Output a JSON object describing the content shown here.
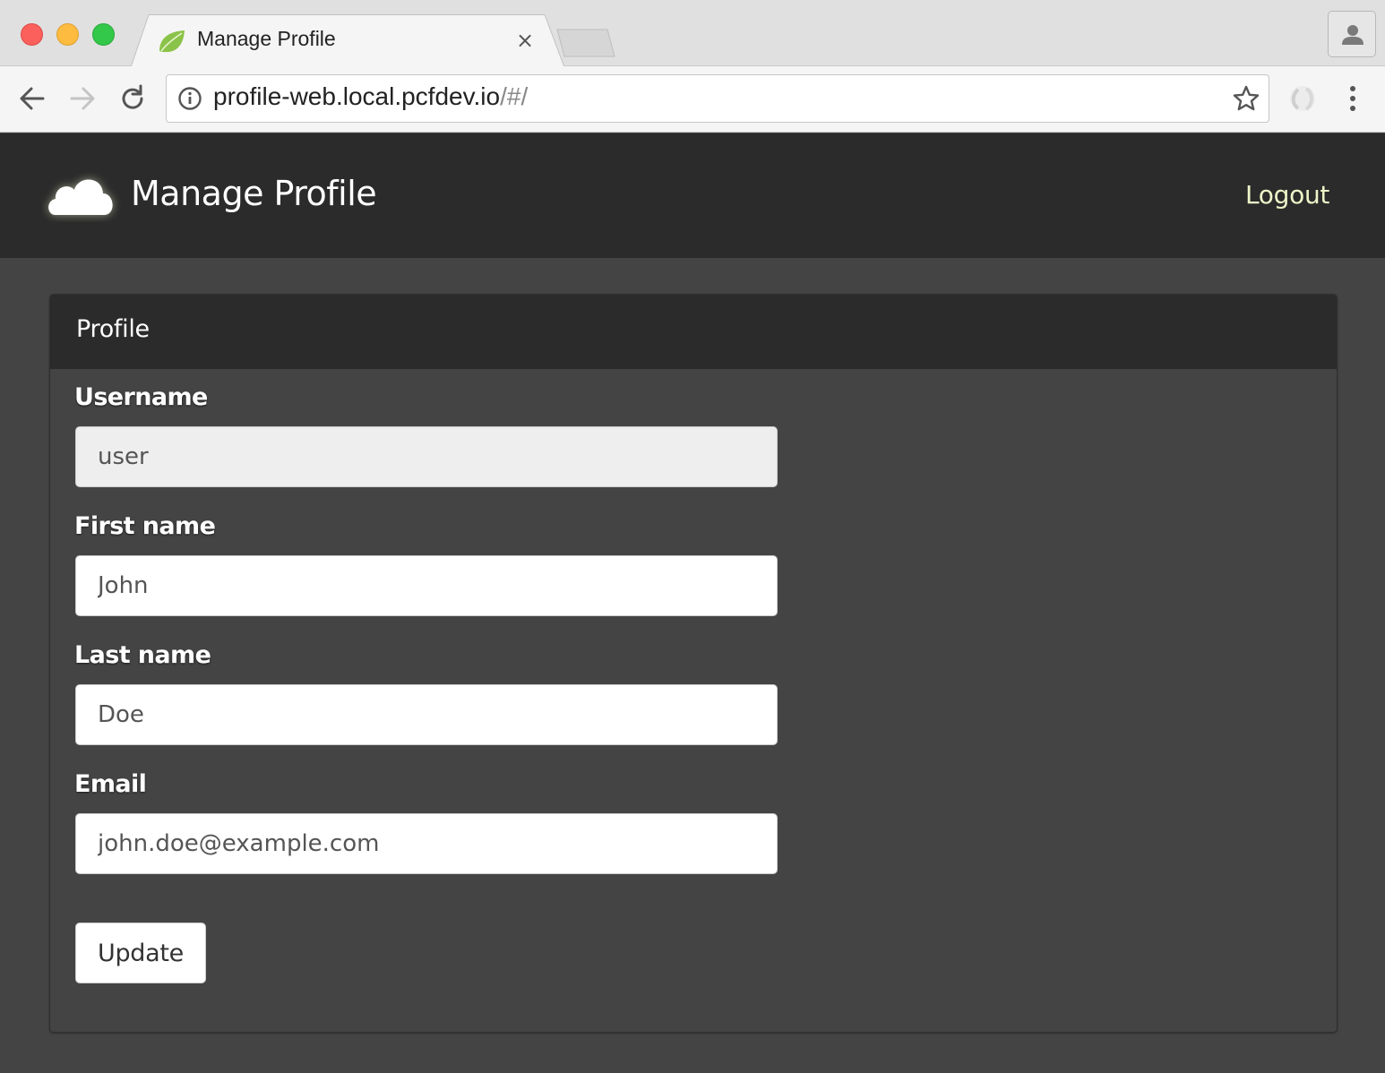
{
  "browser": {
    "tab_title": "Manage Profile",
    "tab_close": "×",
    "url_host": "profile-web.local.pcfdev.io",
    "url_path": "/#/"
  },
  "navbar": {
    "title": "Manage Profile",
    "logout_label": "Logout"
  },
  "panel": {
    "title": "Profile"
  },
  "form": {
    "username": {
      "label": "Username",
      "value": "user"
    },
    "first_name": {
      "label": "First name",
      "value": "John"
    },
    "last_name": {
      "label": "Last name",
      "value": "Doe"
    },
    "email": {
      "label": "Email",
      "value": "john.doe@example.com"
    },
    "submit_label": "Update"
  },
  "colors": {
    "navbar_bg": "#2b2b2b",
    "page_bg": "#444444",
    "logout_link": "#eef5c9",
    "favicon": "#8bc34a"
  }
}
